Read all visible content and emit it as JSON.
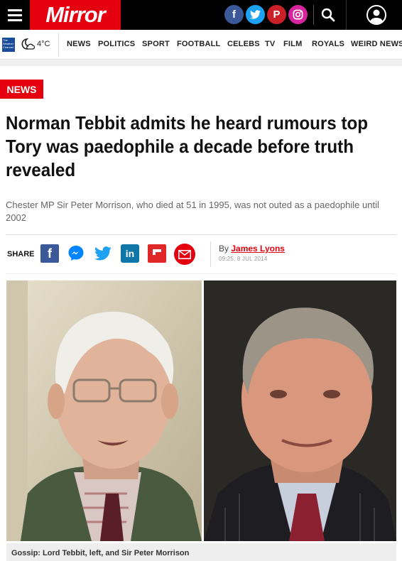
{
  "header": {
    "logo": "Mirror",
    "social": [
      {
        "name": "facebook-icon",
        "glyph": "f",
        "color": "#3b5998"
      },
      {
        "name": "twitter-icon",
        "glyph": "t",
        "color": "#1da1f2"
      },
      {
        "name": "pinterest-icon",
        "glyph": "P",
        "color": "#cb2027"
      },
      {
        "name": "instagram-icon",
        "glyph": "◎",
        "color": "#d6249f"
      }
    ],
    "brand_color": "#e4000f"
  },
  "weather": {
    "logo_text": "The Weather Channel",
    "temp": "4°C"
  },
  "nav": {
    "items": [
      "NEWS",
      "POLITICS",
      "SPORT",
      "FOOTBALL",
      "CELEBS",
      "TV",
      "FILM",
      "ROYALS",
      "WEIRD NEWS"
    ]
  },
  "article": {
    "section": "NEWS",
    "headline": "Norman Tebbit admits he heard rumours top Tory was paedophile a decade before truth revealed",
    "standfirst": "Chester MP Sir Peter Morrison, who died at 51 in 1995, was not outed as a paedophile until 2002",
    "share_label": "SHARE",
    "share_icons": [
      "facebook",
      "messenger",
      "twitter",
      "linkedin",
      "flipboard",
      "email"
    ],
    "byline_prefix": "By",
    "author": "James Lyons",
    "timestamp": "09:25, 8 JUL 2014",
    "caption": "Gossip: Lord Tebbit, left, and Sir Peter Morrison"
  }
}
